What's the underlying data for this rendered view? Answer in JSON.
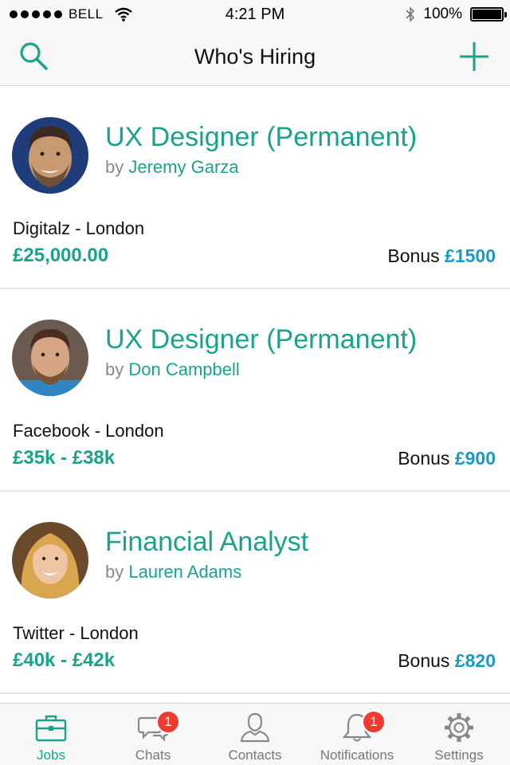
{
  "status_bar": {
    "carrier": "BELL",
    "time": "4:21 PM",
    "battery": "100%"
  },
  "nav": {
    "title": "Who's Hiring"
  },
  "jobs": [
    {
      "title": "UX Designer (Permanent)",
      "by_prefix": "by",
      "poster": "Jeremy Garza",
      "company": "Digitalz - London",
      "salary": "£25,000.00",
      "bonus_label": "Bonus",
      "bonus_amount": "£1500"
    },
    {
      "title": "UX Designer (Permanent)",
      "by_prefix": "by",
      "poster": "Don Campbell",
      "company": "Facebook - London",
      "salary": "£35k - £38k",
      "bonus_label": "Bonus",
      "bonus_amount": "£900"
    },
    {
      "title": "Financial Analyst",
      "by_prefix": "by",
      "poster": "Lauren Adams",
      "company": "Twitter - London",
      "salary": "£40k - £42k",
      "bonus_label": "Bonus",
      "bonus_amount": "£820"
    }
  ],
  "tabs": [
    {
      "label": "Jobs",
      "icon": "briefcase-icon",
      "active": true
    },
    {
      "label": "Chats",
      "icon": "chat-bubbles-icon",
      "badge": "1"
    },
    {
      "label": "Contacts",
      "icon": "person-icon"
    },
    {
      "label": "Notifications",
      "icon": "bell-icon",
      "badge": "1"
    },
    {
      "label": "Settings",
      "icon": "gear-icon"
    }
  ],
  "colors": {
    "accent": "#1aa389",
    "bonus": "#1a98c8",
    "badge": "#f03a2e"
  }
}
